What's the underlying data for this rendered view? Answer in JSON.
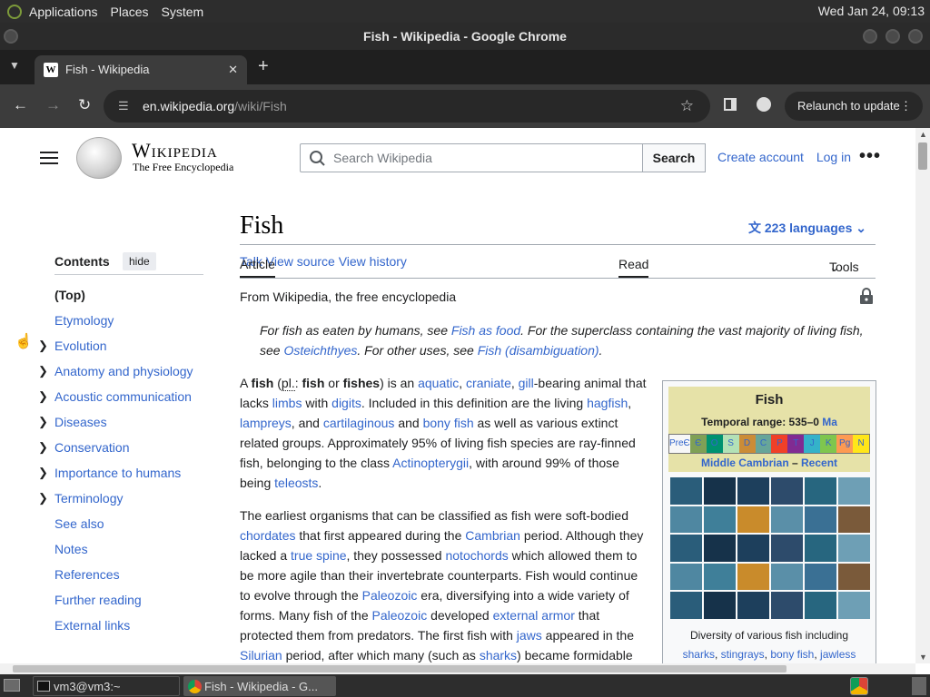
{
  "system_bar": {
    "menu": [
      "Applications",
      "Places",
      "System"
    ],
    "clock": "Wed Jan 24, 09:13"
  },
  "window": {
    "title": "Fish - Wikipedia - Google Chrome"
  },
  "browser": {
    "tab_title": "Fish - Wikipedia",
    "tab_favicon": "W",
    "url_host": "en.wikipedia.org",
    "url_path": "/wiki/Fish",
    "relaunch_label": "Relaunch to update"
  },
  "header": {
    "wordmark": "Wikipedia",
    "tagline": "The Free Encyclopedia",
    "search_placeholder": "Search Wikipedia",
    "search_button": "Search",
    "create_account": "Create account",
    "login": "Log in"
  },
  "toc": {
    "title": "Contents",
    "hide": "hide",
    "items": [
      {
        "label": "(Top)",
        "expandable": false
      },
      {
        "label": "Etymology",
        "expandable": false
      },
      {
        "label": "Evolution",
        "expandable": true
      },
      {
        "label": "Anatomy and physiology",
        "expandable": true
      },
      {
        "label": "Acoustic communication",
        "expandable": true
      },
      {
        "label": "Diseases",
        "expandable": true
      },
      {
        "label": "Conservation",
        "expandable": true
      },
      {
        "label": "Importance to humans",
        "expandable": true
      },
      {
        "label": "Terminology",
        "expandable": true
      },
      {
        "label": "See also",
        "expandable": false
      },
      {
        "label": "Notes",
        "expandable": false
      },
      {
        "label": "References",
        "expandable": false
      },
      {
        "label": "Further reading",
        "expandable": false
      },
      {
        "label": "External links",
        "expandable": false
      }
    ]
  },
  "article": {
    "title": "Fish",
    "languages": "223 languages",
    "tabs": {
      "article": "Article",
      "talk": "Talk",
      "read": "Read",
      "view_source": "View source",
      "view_history": "View history",
      "tools": "Tools"
    },
    "from": "From Wikipedia, the free encyclopedia",
    "hatnote": {
      "t1": "For fish as eaten by humans, see ",
      "l1": "Fish as food",
      "t2": ". For the superclass containing the vast majority of living fish, see ",
      "l2": "Osteichthyes",
      "t3": ". For other uses, see ",
      "l3": "Fish (disambiguation)",
      "t4": "."
    },
    "p1": {
      "a": "A ",
      "fish": "fish",
      "b": " (",
      "pl": "pl.",
      "c": ": ",
      "fish2": "fish",
      "d": " or ",
      "fishes": "fishes",
      "e": ") is an ",
      "aquatic": "aquatic",
      "f": ", ",
      "craniate": "craniate",
      "g": ", ",
      "gill": "gill",
      "h": "-bearing animal that lacks ",
      "limbs": "limbs",
      "i": " with ",
      "digits": "digits",
      "j": ". Included in this definition are the living ",
      "hagfish": "hagfish",
      "k": ", ",
      "lampreys": "lampreys",
      "l": ", and ",
      "cartilaginous": "cartilaginous",
      "m": " and ",
      "bony": "bony fish",
      "n": " as well as various extinct related groups. Approximately 95% of living fish species are ray-finned fish, belonging to the class ",
      "actino": "Actinopterygii",
      "o": ", with around 99% of those being ",
      "teleosts": "teleosts",
      "p": "."
    },
    "p2": {
      "a": "The earliest organisms that can be classified as fish were soft-bodied ",
      "chordates": "chordates",
      "b": " that first appeared during the ",
      "cambrian": "Cambrian",
      "c": " period. Although they lacked a ",
      "spine": "true spine",
      "d": ", they possessed ",
      "notochords": "notochords",
      "e": " which allowed them to be more agile than their invertebrate counterparts. Fish would continue to evolve through the ",
      "paleozoic": "Paleozoic",
      "f": " era, diversifying into a wide variety of forms. Many fish of the ",
      "paleozoic2": "Paleozoic",
      "g": " developed ",
      "armor": "external armor",
      "h": " that protected them from predators. The first fish with ",
      "jaws": "jaws",
      "i": " appeared in the ",
      "silurian": "Silurian",
      "j": " period, after which many (such as ",
      "sharks": "sharks",
      "k": ") became formidable"
    }
  },
  "infobox": {
    "title": "Fish",
    "range_label": "Temporal range: 535–0 ",
    "range_unit": "Ma",
    "timeline": [
      "PreЄ",
      "Є",
      "O",
      "S",
      "D",
      "C",
      "P",
      "T",
      "J",
      "K",
      "Pg",
      "N"
    ],
    "timeline_colors": [
      "#f7f7f7",
      "#7fa056",
      "#009270",
      "#b3e1b6",
      "#cb8c37",
      "#67a599",
      "#f04028",
      "#812b92",
      "#34b2c9",
      "#7fc64e",
      "#fd9a52",
      "#ffe619"
    ],
    "span_from": "Middle Cambrian",
    "span_sep": " – ",
    "span_to": "Recent",
    "caption_text": "Diversity of various fish including",
    "caption_links": [
      "sharks",
      "stingrays",
      "bony fish",
      "jawless"
    ]
  },
  "taskbar": {
    "terminal": "vm3@vm3:~",
    "chrome": "Fish - Wikipedia - G..."
  }
}
